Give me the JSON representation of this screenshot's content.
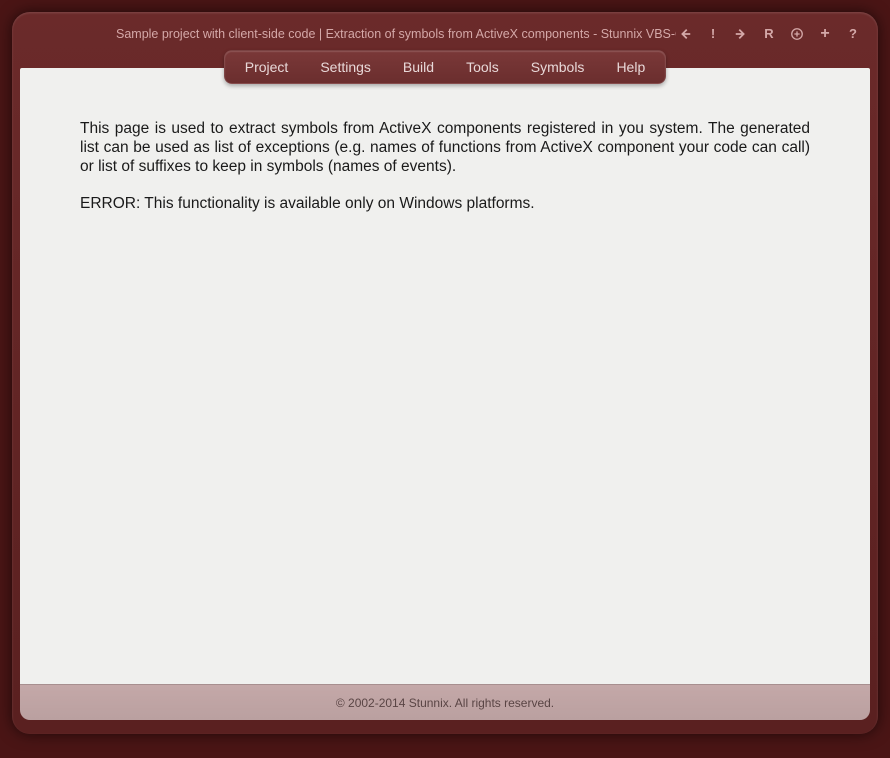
{
  "title": "Sample project with client-side code | Extraction of symbols from ActiveX components - Stunnix VBS-Obfus Proje",
  "menu": {
    "items": [
      {
        "label": "Project"
      },
      {
        "label": "Settings"
      },
      {
        "label": "Build"
      },
      {
        "label": "Tools"
      },
      {
        "label": "Symbols"
      },
      {
        "label": "Help"
      }
    ]
  },
  "content": {
    "description": "This page is used to extract symbols from ActiveX components registered in you system. The generated list can be used as list of exceptions (e.g. names of functions from ActiveX component your code can call) or list of suffixes to keep in symbols (names of events).",
    "error": "ERROR: This functionality is available only on Windows platforms."
  },
  "footer": {
    "copyright": "© 2002-2014 Stunnix. All rights reserved."
  },
  "titlebar_icons": {
    "back": "←",
    "stop": "!",
    "forward": "→",
    "reload": "R",
    "zoom": "⊕",
    "add": "+",
    "help": "?"
  }
}
